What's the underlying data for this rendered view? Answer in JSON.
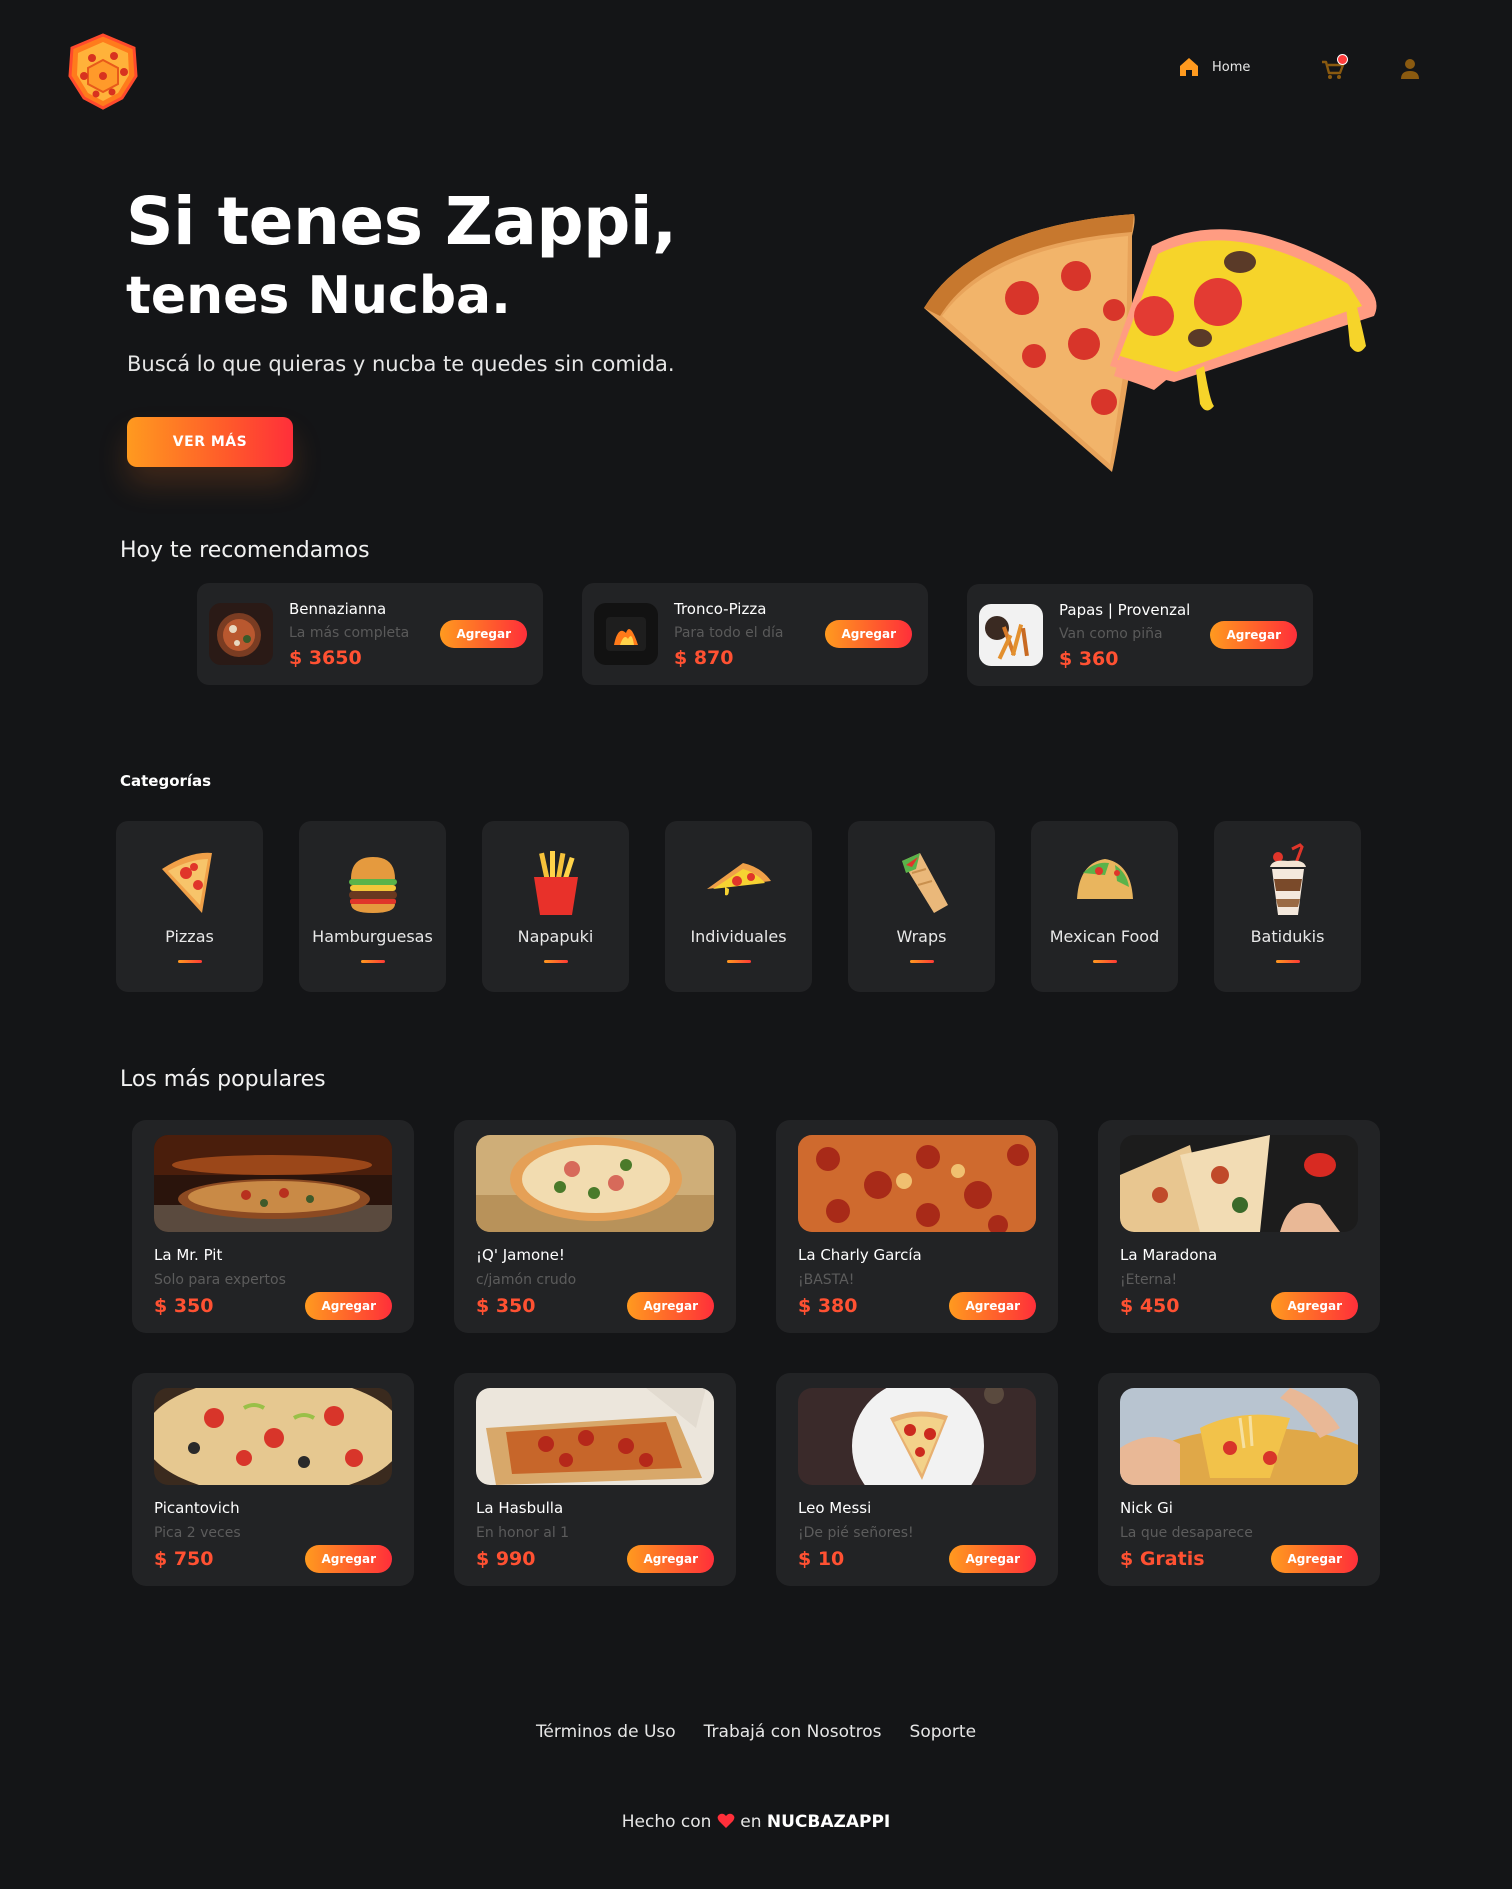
{
  "nav": {
    "home_label": "Home",
    "cart_badge_color": "#ff3d3d"
  },
  "hero": {
    "title": "Si tenes Zappi,",
    "subtitle": "tenes Nucba.",
    "description": "Buscá lo que quieras y nucba te quedes sin comida.",
    "cta_label": "VER MÁS"
  },
  "recommended": {
    "title": "Hoy te recomendamos",
    "items": [
      {
        "name": "Bennazianna",
        "desc": "La más completa",
        "price": "$ 3650",
        "button": "Agregar"
      },
      {
        "name": "Tronco-Pizza",
        "desc": "Para todo el día",
        "price": "$ 870",
        "button": "Agregar"
      },
      {
        "name": "Papas | Provenzal",
        "desc": "Van como piña",
        "price": "$ 360",
        "button": "Agregar"
      }
    ]
  },
  "categories": {
    "title": "Categorías",
    "items": [
      {
        "label": "Pizzas",
        "icon": "pizza-slice-icon"
      },
      {
        "label": "Hamburguesas",
        "icon": "burger-icon"
      },
      {
        "label": "Napapuki",
        "icon": "fries-icon"
      },
      {
        "label": "Individuales",
        "icon": "pizza-piece-icon"
      },
      {
        "label": "Wraps",
        "icon": "wrap-icon"
      },
      {
        "label": "Mexican Food",
        "icon": "taco-icon"
      },
      {
        "label": "Batidukis",
        "icon": "milkshake-icon"
      }
    ]
  },
  "popular": {
    "title": "Los más populares",
    "items": [
      {
        "name": "La Mr. Pit",
        "desc": "Solo para expertos",
        "price": "$ 350",
        "button": "Agregar"
      },
      {
        "name": "¡Q' Jamone!",
        "desc": "c/jamón crudo",
        "price": "$ 350",
        "button": "Agregar"
      },
      {
        "name": "La Charly García",
        "desc": "¡BASTA!",
        "price": "$ 380",
        "button": "Agregar"
      },
      {
        "name": "La Maradona",
        "desc": "¡Eterna!",
        "price": "$ 450",
        "button": "Agregar"
      },
      {
        "name": "Picantovich",
        "desc": "Pica 2 veces",
        "price": "$ 750",
        "button": "Agregar"
      },
      {
        "name": "La Hasbulla",
        "desc": "En honor al 1",
        "price": "$ 990",
        "button": "Agregar"
      },
      {
        "name": "Leo Messi",
        "desc": "¡De pié señores!",
        "price": "$ 10",
        "button": "Agregar"
      },
      {
        "name": "Nick Gi",
        "desc": "La que desaparece",
        "price": "$ Gratis",
        "button": "Agregar"
      }
    ]
  },
  "footer": {
    "links": [
      "Términos de Uso",
      "Trabajá con Nosotros",
      "Soporte"
    ],
    "made_prefix": "Hecho con",
    "made_middle": "en",
    "brand": "NUCBAZAPPI"
  },
  "colors": {
    "background": "#141517",
    "card": "#222325",
    "accent_orange": "#ff9a1f",
    "accent_red": "#ff3a35",
    "price": "#ff5132"
  }
}
